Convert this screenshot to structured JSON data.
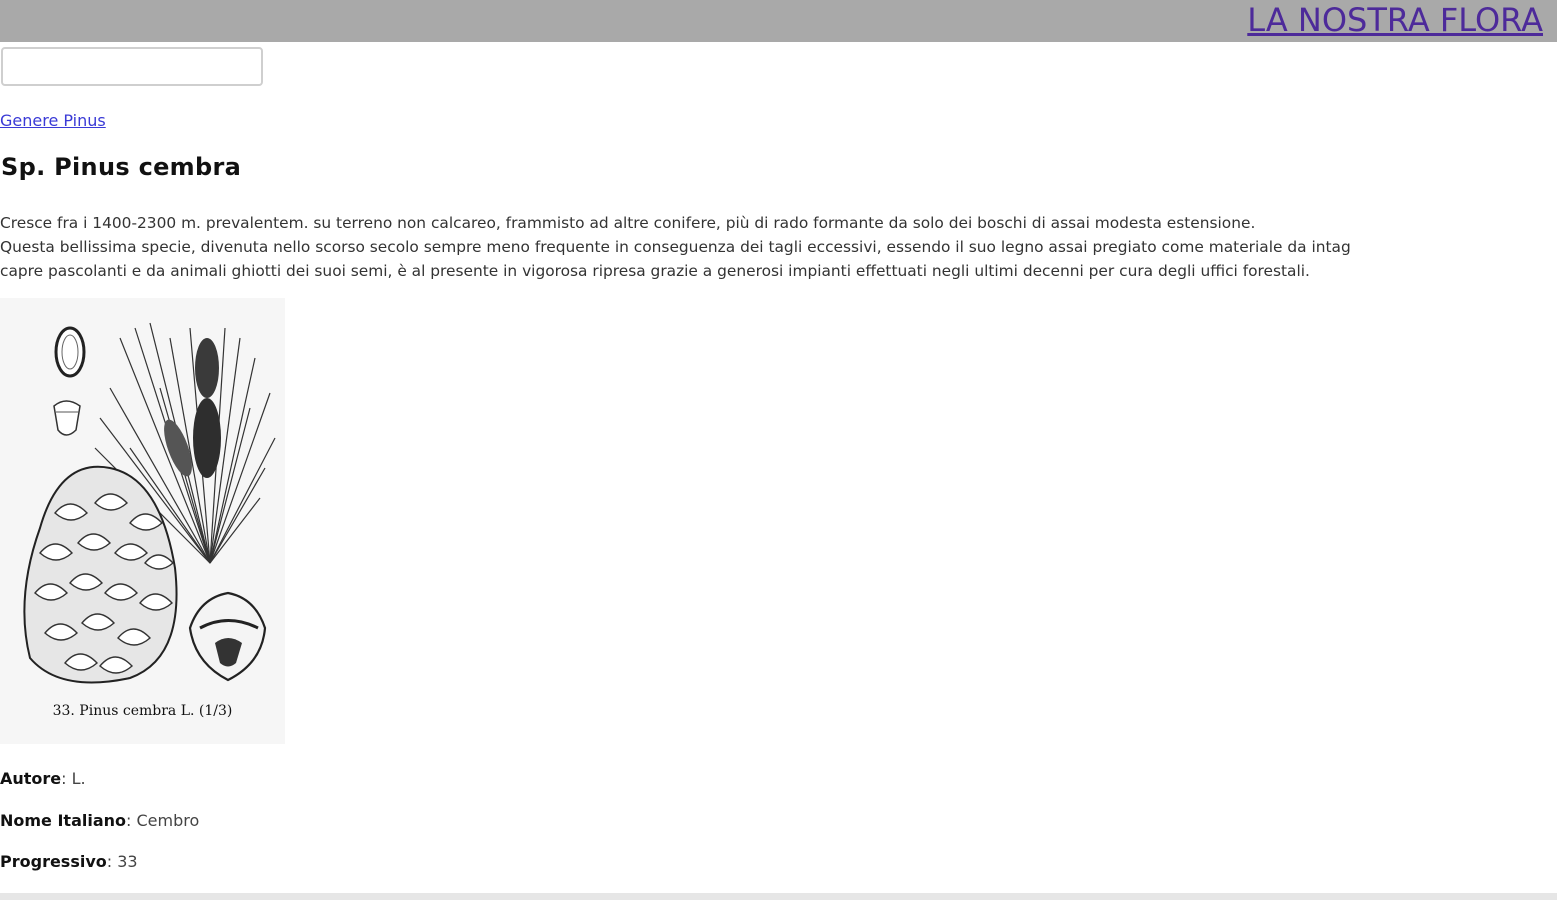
{
  "header": {
    "site_title": "LA NOSTRA FLORA"
  },
  "search": {
    "value": "",
    "placeholder": ""
  },
  "breadcrumb": {
    "label": "Genere Pinus"
  },
  "page": {
    "title": "Sp. Pinus cembra",
    "description_lines": [
      "Cresce fra i 1400-2300 m. prevalentem. su terreno non calcareo, frammisto ad altre conifere, più di rado formante da solo dei boschi di assai modesta estensione.",
      "Questa bellissima specie, divenuta nello scorso secolo sempre meno frequente in conseguenza dei tagli eccessivi, essendo il suo legno assai pregiato come materiale da intag",
      "capre pascolanti e da animali ghiotti dei suoi semi, è al presente in vigorosa ripresa grazie a generosi impianti effettuati negli ultimi decenni per cura degli uffici forestali."
    ]
  },
  "figure": {
    "caption": "33. Pinus cembra L. (1/3)"
  },
  "details": {
    "autore_label": "Autore",
    "autore_value": ": L.",
    "nome_label": "Nome Italiano",
    "nome_value": ": Cembro",
    "progressivo_label": "Progressivo",
    "progressivo_value": ": 33"
  },
  "colors": {
    "header_bg": "#a9a9a9",
    "title_link": "#4d2a9a",
    "link": "#3a3ad6"
  }
}
